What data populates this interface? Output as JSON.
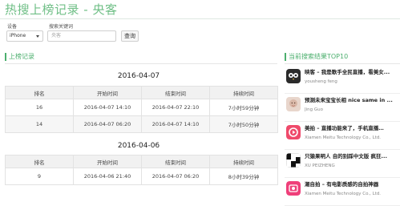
{
  "header": {
    "title": "热搜上榜记录 - 央客"
  },
  "search": {
    "device_label": "设备",
    "device_value": "iPhone",
    "keyword_label": "搜索关键词",
    "keyword_placeholder": "央客",
    "query_button": "查询"
  },
  "history": {
    "section_title": "上榜记录",
    "columns": [
      "排名",
      "开始时间",
      "结束时间",
      "持续时间"
    ],
    "groups": [
      {
        "date": "2016-04-07",
        "rows": [
          {
            "rank": "16",
            "start": "2016-04-07 14:10",
            "end": "2016-04-07 22:10",
            "duration": "7小时59分钟"
          },
          {
            "rank": "14",
            "start": "2016-04-07 06:20",
            "end": "2016-04-07 14:10",
            "duration": "7小时50分钟"
          }
        ]
      },
      {
        "date": "2016-04-06",
        "rows": [
          {
            "rank": "9",
            "start": "2016-04-06 21:40",
            "end": "2016-04-07 06:20",
            "duration": "8小时39分钟"
          }
        ]
      }
    ]
  },
  "top10": {
    "section_title": "当前搜索结果TOP10",
    "items": [
      {
        "name": "映客 – 我是歌手全民直播，看美女...",
        "developer": "yousheng feng",
        "icon": "owl-icon",
        "color": "#2b2b2b"
      },
      {
        "name": "预测未来宝宝长相 nice same in ...",
        "developer": "Jing Guo",
        "icon": "baby-photo-icon",
        "color": "#d9b8a8"
      },
      {
        "name": "美拍 – 直播功能来了，手机直播…",
        "developer": "Xiamen Meitu Technology Co., Ltd.",
        "icon": "meipai-icon",
        "color": "#ef4a6b"
      },
      {
        "name": "只猿果明人 自的别踩中文版 疯狂...",
        "developer": "XU PEIZHENG",
        "icon": "piano-tiles-icon",
        "color": "#111111"
      },
      {
        "name": "潮自拍 – 有电影质感的自拍神器",
        "developer": "Xiamen Meitu Technology Co., Ltd.",
        "icon": "chaozipai-icon",
        "color": "#ef3f7a"
      }
    ]
  }
}
